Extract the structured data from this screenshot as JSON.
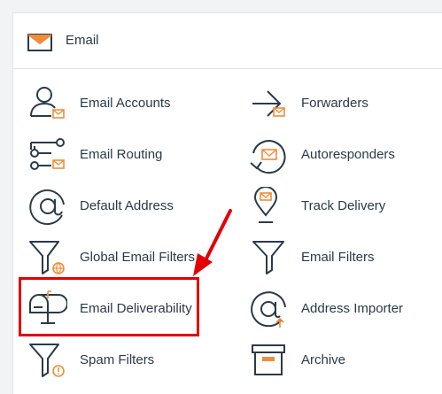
{
  "section": {
    "title": "Email",
    "icon": "envelope-icon"
  },
  "items": [
    {
      "label": "Email Accounts",
      "icon": "email-accounts-icon"
    },
    {
      "label": "Forwarders",
      "icon": "forwarders-icon"
    },
    {
      "label": "Email Routing",
      "icon": "email-routing-icon"
    },
    {
      "label": "Autoresponders",
      "icon": "autoresponders-icon"
    },
    {
      "label": "Default Address",
      "icon": "default-address-icon"
    },
    {
      "label": "Track Delivery",
      "icon": "track-delivery-icon"
    },
    {
      "label": "Global Email Filters",
      "icon": "global-email-filters-icon"
    },
    {
      "label": "Email Filters",
      "icon": "email-filters-icon"
    },
    {
      "label": "Email Deliverability",
      "icon": "email-deliverability-icon"
    },
    {
      "label": "Address Importer",
      "icon": "address-importer-icon"
    },
    {
      "label": "Spam Filters",
      "icon": "spam-filters-icon"
    },
    {
      "label": "Archive",
      "icon": "archive-icon"
    }
  ],
  "annotation": {
    "highlighted_item": "Email Deliverability",
    "color": "#e30000"
  },
  "colors": {
    "icon_stroke": "#293a4a",
    "icon_accent": "#f28c38",
    "text": "#293a4a"
  }
}
